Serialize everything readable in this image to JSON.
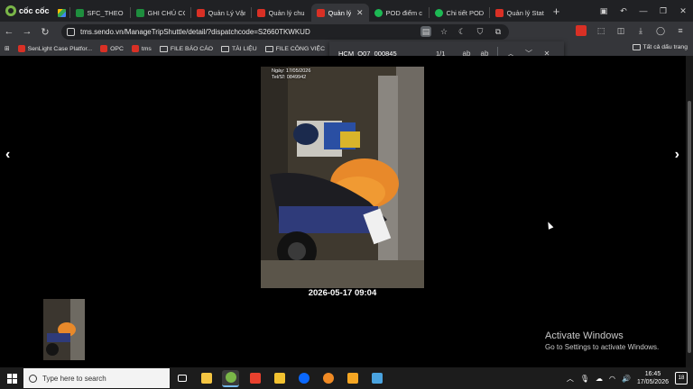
{
  "browser": {
    "brand": "cốc cốc",
    "tabs": [
      {
        "label": "",
        "icon": "drive-icon",
        "active": false
      },
      {
        "label": "SFC_THEO D",
        "icon": "sheet-icon",
        "active": false
      },
      {
        "label": "GHI CHÚ CÓ",
        "icon": "sheet-icon",
        "active": false
      },
      {
        "label": "Quản Lý Vận",
        "icon": "sendo-icon",
        "active": false
      },
      {
        "label": "Quản lý chu",
        "icon": "sendo-icon",
        "active": false
      },
      {
        "label": "Quản lý",
        "icon": "sendo-icon",
        "active": true
      },
      {
        "label": "POD điểm c",
        "icon": "spotify-icon",
        "active": false
      },
      {
        "label": "Chi tiết POD",
        "icon": "spotify-icon",
        "active": false
      },
      {
        "label": "Quản lý Stat",
        "icon": "sendo-icon",
        "active": false
      }
    ],
    "url": "tms.sendo.vn/ManageTripShuttle/detail/?dispatchcode=S2660TKWKUD"
  },
  "bookmarks": {
    "items": [
      {
        "label": "SenLight Case Platfor...",
        "icon": "sendo-icon"
      },
      {
        "label": "OPC",
        "icon": "sendo-icon"
      },
      {
        "label": "tms",
        "icon": "sendo-icon"
      },
      {
        "label": "FILE BÁO CÁO",
        "icon": "folder-icon"
      },
      {
        "label": "TÀI LIỆU",
        "icon": "folder-icon"
      },
      {
        "label": "FILE CÔNG VIỆC",
        "icon": "folder-icon"
      }
    ],
    "all_bookmarks": "Tất cả dấu trang"
  },
  "find": {
    "query": "HCM_Q07_000845",
    "count": "1/1"
  },
  "viewer": {
    "prev_symbol": "‹",
    "next_symbol": "›",
    "photo_stamp": [
      "Ngày: 17/05/2026",
      "Tel/Sĩ: 0849942"
    ],
    "caption": "2026-05-17 09:04"
  },
  "watermark": {
    "line1": "Activate Windows",
    "line2": "Go to Settings to activate Windows."
  },
  "taskbar": {
    "search_placeholder": "Type here to search",
    "time": "16:45",
    "date": "17/05/2026",
    "notif_count": "18"
  },
  "colors": {
    "accent": "#76b9ed",
    "sendo_red": "#d93025",
    "sheet_green": "#188038"
  }
}
